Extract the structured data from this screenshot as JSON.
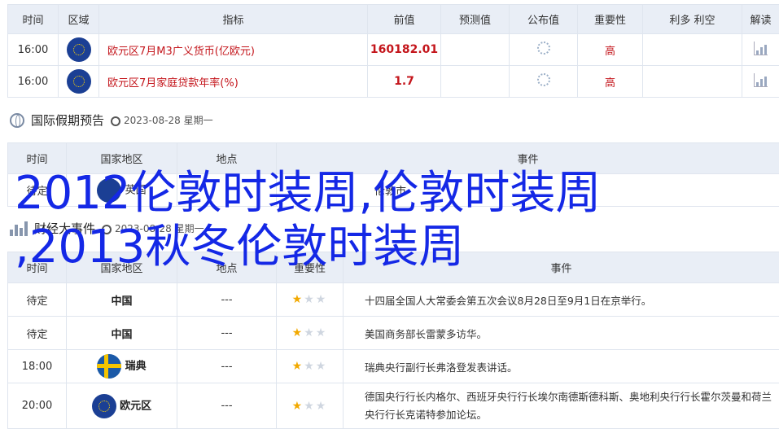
{
  "top_table": {
    "headers": [
      "时间",
      "区域",
      "指标",
      "前值",
      "预测值",
      "公布值",
      "重要性",
      "利多 利空",
      "解读"
    ],
    "rows": [
      {
        "time": "16:00",
        "indicator": "欧元区7月M3广义货币(亿欧元)",
        "prev": "160182.01",
        "importance": "高"
      },
      {
        "time": "16:00",
        "indicator": "欧元区7月家庭贷款年率(%)",
        "prev": "1.7",
        "importance": "高"
      }
    ]
  },
  "holiday_section": {
    "title": "国际假期预告",
    "date": "2023-08-28 星期一"
  },
  "holiday_table": {
    "headers": [
      "时间",
      "国家地区",
      "地点",
      "事件"
    ],
    "row": {
      "time": "待定",
      "country": "英国",
      "place": "",
      "event": "伦敦市"
    }
  },
  "events_section": {
    "title": "财经大事件",
    "date": "2023-08-28 星期一"
  },
  "events_table": {
    "headers": [
      "时间",
      "国家地区",
      "地点",
      "重要性",
      "事件"
    ],
    "rows": [
      {
        "time": "待定",
        "country": "中国",
        "place": "---",
        "event": "十四届全国人大常委会第五次会议8月28日至9月1日在京举行。"
      },
      {
        "time": "待定",
        "country": "中国",
        "place": "---",
        "event": "美国商务部长雷蒙多访华。"
      },
      {
        "time": "18:00",
        "country": "瑞典",
        "place": "---",
        "event": "瑞典央行副行长弗洛登发表讲话。"
      },
      {
        "time": "20:00",
        "country": "欧元区",
        "place": "---",
        "event": "德国央行行长内格尔、西班牙央行行长埃尔南德斯德科斯、奥地利央行行长霍尔茨曼和荷兰央行行长克诺特参加论坛。"
      }
    ]
  },
  "overlay_text": "2012伦敦时装周,伦敦时装周\n,2013秋冬伦敦时装周"
}
